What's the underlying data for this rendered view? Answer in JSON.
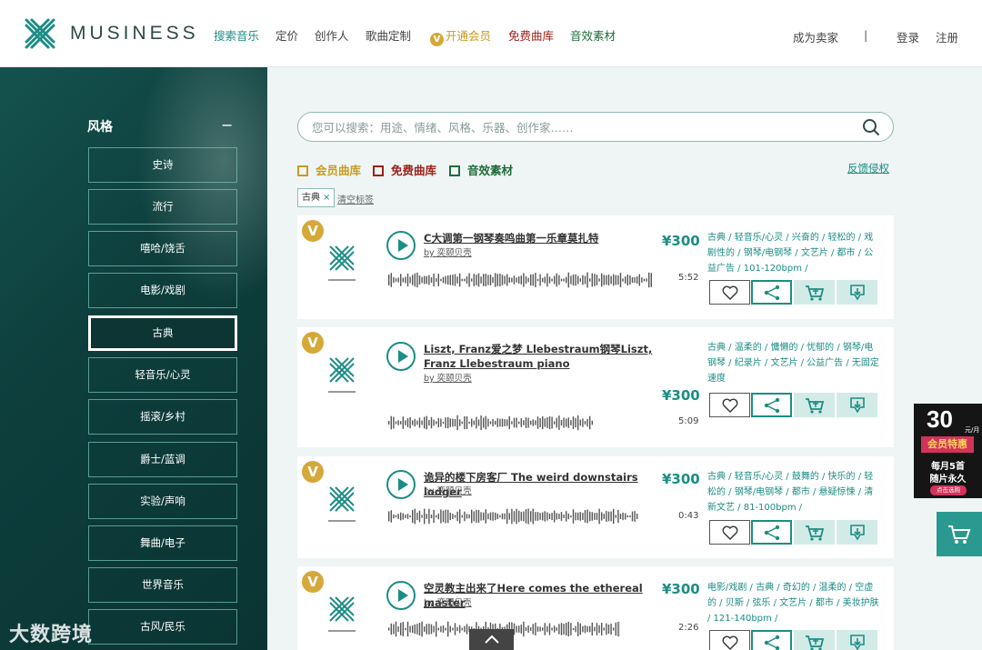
{
  "header": {
    "brand": "MUSINESS",
    "nav": [
      {
        "label": "搜索音乐"
      },
      {
        "label": "定价"
      },
      {
        "label": "创作人"
      },
      {
        "label": "歌曲定制"
      },
      {
        "label": "开通会员"
      },
      {
        "label": "免费曲库"
      },
      {
        "label": "音效素材"
      }
    ],
    "vip_badge": "V",
    "seller": "成为卖家",
    "divider": "|",
    "login": "登录",
    "register": "注册"
  },
  "sidebar": {
    "title": "风格",
    "collapse": "−",
    "items": [
      {
        "label": "史诗"
      },
      {
        "label": "流行"
      },
      {
        "label": "嘻哈/饶舌"
      },
      {
        "label": "电影/戏剧"
      },
      {
        "label": "古典",
        "active": true
      },
      {
        "label": "轻音乐/心灵"
      },
      {
        "label": "摇滚/乡村"
      },
      {
        "label": "爵士/蓝调"
      },
      {
        "label": "实验/声响"
      },
      {
        "label": "舞曲/电子"
      },
      {
        "label": "世界音乐"
      },
      {
        "label": "古风/民乐"
      }
    ],
    "watermark": "大数跨境"
  },
  "search": {
    "placeholder": "您可以搜索：用途、情绪、风格、乐器、创作家……"
  },
  "filters": {
    "member_library": "会员曲库",
    "free_library": "免费曲库",
    "sound_effects": "音效素材",
    "report": "反馈侵权",
    "active_tag": "古典",
    "tag_remove": "×",
    "clear_tags": "清空标签"
  },
  "colors": {
    "accent": "#1b8d85",
    "vip_gold": "#d6a83a",
    "free_red": "#a0211c",
    "sfx_green": "#1f6b3a",
    "sidebar_bg": "#0d3f3d"
  },
  "tracks": [
    {
      "vip": "V",
      "title": "C大调第一钢琴奏鸣曲第一乐章莫扎特",
      "artist": "by 奕颐贝壳",
      "duration": "5:52",
      "price": "¥300",
      "tags": "古典 / 轻音乐/心灵 / 兴奋的 / 轻松的 / 戏剧性的 / 钢琴/电钢琴 / 文艺片 / 都市 / 公益广告 / 101-120bpm /"
    },
    {
      "vip": "V",
      "title": "Liszt, Franz爱之梦 Llebestraum钢琴Liszt, Franz Llebestraum piano",
      "artist": "by 奕颐贝壳",
      "duration": "5:09",
      "price": "¥300",
      "tags": "古典 / 温柔的 / 慵懒的 / 忧郁的 / 钢琴/电钢琴 / 纪录片 / 文艺片 / 公益广告 / 无固定速度"
    },
    {
      "vip": "V",
      "title": "诡异的楼下房客厂 The weird downstairs lodger",
      "artist": "by 奕颐贝壳",
      "duration": "0:43",
      "price": "¥300",
      "tags": "古典 / 轻音乐/心灵 / 鼓舞的 / 快乐的 / 轻松的 / 钢琴/电钢琴 / 都市 / 悬疑惊悚 / 清新文艺 / 81-100bpm /"
    },
    {
      "vip": "V",
      "title": "空灵教主出来了Here comes the ethereal master",
      "artist": "by 奕颐贝壳",
      "duration": "2:26",
      "price": "¥300",
      "tags": "电影/戏剧 / 古典 / 奇幻的 / 温柔的 / 空虚的 / 贝斯 / 弦乐 / 文艺片 / 都市 / 美妆护肤 / 121-140bpm /"
    }
  ],
  "promo": {
    "amount": "30",
    "unit": "元/月",
    "ribbon": "会员特惠",
    "line1": "每月5首",
    "line2": "随片永久",
    "button": "点击选购"
  }
}
